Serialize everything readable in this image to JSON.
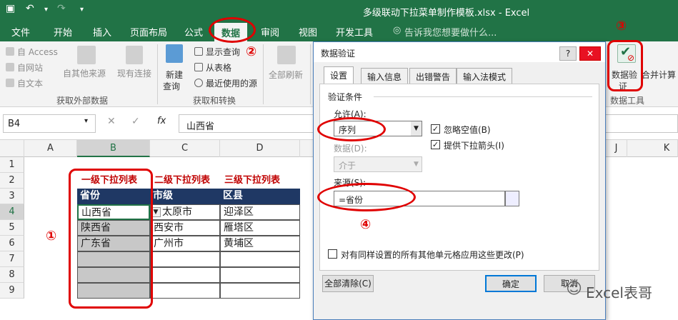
{
  "window": {
    "title": "多级联动下拉菜单制作模板.xlsx - Excel"
  },
  "tabs": [
    "文件",
    "开始",
    "插入",
    "页面布局",
    "公式",
    "数据",
    "审阅",
    "视图",
    "开发工具"
  ],
  "tell_me": "告诉我您想要做什么...",
  "ribbon": {
    "ext": {
      "access": "自 Access",
      "web": "自网站",
      "text": "自文本",
      "other": "自其他来源",
      "existing": "现有连接",
      "label": "获取外部数据"
    },
    "transform": {
      "new_query_1": "新建",
      "new_query_2": "查询",
      "show_query": "显示查询",
      "from_table": "从表格",
      "recent": "最近使用的源",
      "label": "获取和转换"
    },
    "refresh": "全部刷新",
    "tools": {
      "validate_1": "数据验",
      "validate_2": "证",
      "merge": "合并计算",
      "label": "数据工具"
    }
  },
  "formula_bar": {
    "namebox": "B4",
    "fx": "fx",
    "content": "山西省"
  },
  "columns": [
    "A",
    "B",
    "C",
    "D",
    "J",
    "K"
  ],
  "rows": [
    "1",
    "2",
    "3",
    "4",
    "5",
    "6",
    "7",
    "8",
    "9"
  ],
  "sheet": {
    "lvl1": "一级下拉列表",
    "lvl2": "二级下拉列表",
    "lvl3": "三级下拉列表",
    "hdr_prov": "省份",
    "hdr_city": "市级",
    "hdr_county": "区县",
    "prov": [
      "山西省",
      "陕西省",
      "广东省"
    ],
    "city": [
      "太原市",
      "西安市",
      "广州市"
    ],
    "county": [
      "迎泽区",
      "雁塔区",
      "黄埔区"
    ]
  },
  "dialog": {
    "title": "数据验证",
    "help": "?",
    "close": "✕",
    "tabs": [
      "设置",
      "输入信息",
      "出错警告",
      "输入法模式"
    ],
    "criteria": "验证条件",
    "allow_label": "允许(A):",
    "allow_value": "序列",
    "ignore_blank": "忽略空值(B)",
    "dropdown": "提供下拉箭头(I)",
    "data_label": "数据(D):",
    "data_value": "介于",
    "source_label": "来源(S):",
    "source_value": "=省份",
    "apply_all": "对有同样设置的所有其他单元格应用这些更改(P)",
    "clear": "全部清除(C)",
    "ok": "确定",
    "cancel": "取消"
  },
  "annotations": [
    "①",
    "②",
    "③",
    "④"
  ],
  "watermark": "Excel表哥",
  "colors": {
    "excel_green": "#217346",
    "annotation_red": "#e00000",
    "header_navy": "#1f3864"
  }
}
